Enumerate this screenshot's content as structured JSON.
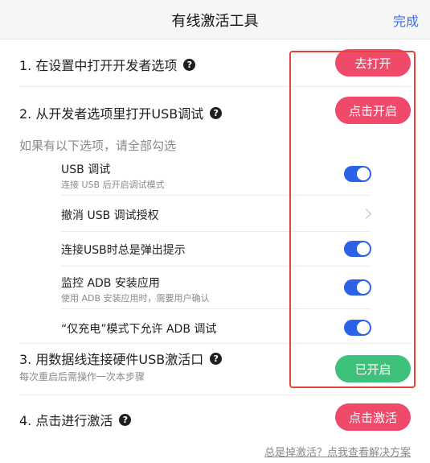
{
  "header": {
    "title": "有线激活工具",
    "done_label": "完成"
  },
  "steps": [
    {
      "label": "1. 在设置中打开开发者选项",
      "button": "去打开",
      "button_color": "#f04a6b"
    },
    {
      "label": "2. 从开发者选项里打开USB调试",
      "button": "点击开启",
      "button_color": "#f04a6b"
    },
    {
      "label": "3. 用数据线连接硬件USB激活口",
      "note": "每次重启后需操作一次本步骤",
      "button": "已开启",
      "button_color": "#3ec17a"
    },
    {
      "label": "4. 点击进行激活",
      "button": "点击激活",
      "button_color": "#f04a6b"
    }
  ],
  "options_hint": "如果有以下选项，请全部勾选",
  "options": [
    {
      "label": "USB 调试",
      "desc": "连接 USB 后开启调试模式",
      "control": "toggle",
      "on": true
    },
    {
      "label": "撤消 USB 调试授权",
      "desc": "",
      "control": "chevron",
      "on": false
    },
    {
      "label": "连接USB时总是弹出提示",
      "desc": "",
      "control": "toggle",
      "on": true
    },
    {
      "label": "监控 ADB 安装应用",
      "desc": "使用 ADB 安装应用时，需要用户确认",
      "control": "toggle",
      "on": true
    },
    {
      "label": "“仅充电”模式下允许 ADB 调试",
      "desc": "",
      "control": "toggle",
      "on": true
    }
  ],
  "footer_link": "总是掉激活？点我查看解决方案",
  "colors": {
    "accent_red": "#f04a6b",
    "accent_green": "#3ec17a",
    "toggle_blue": "#2b62e8",
    "link_blue": "#3f6fe0",
    "highlight_red": "#e5443a"
  }
}
